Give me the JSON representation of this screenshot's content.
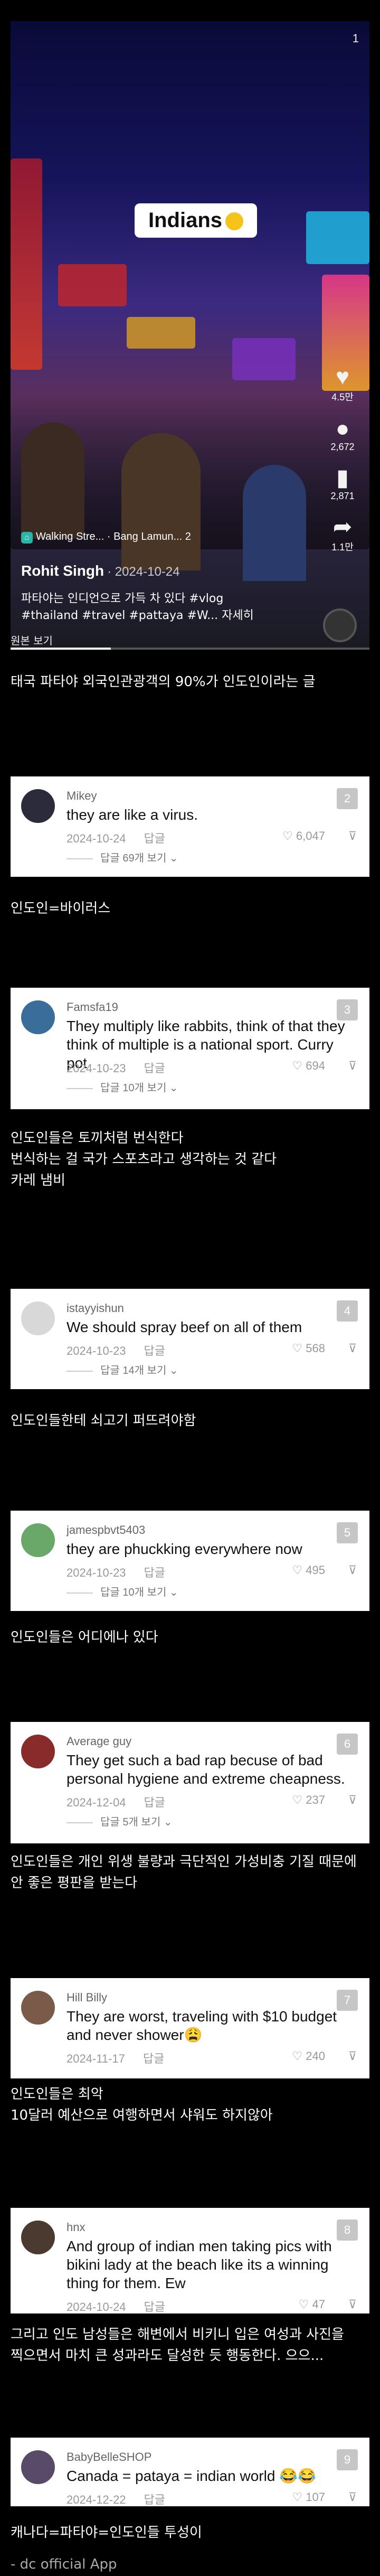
{
  "video": {
    "page_number": "1",
    "caption": "Indians",
    "likes": "4.5만",
    "comments": "2,672",
    "saves": "2,871",
    "shares": "1.1만",
    "location": "Walking Stre... · Bang Lamun...",
    "location_more": "2",
    "author": "Rohit Singh",
    "date": "· 2024-10-24",
    "desc_line1": "파타야는 인디언으로 가득 차 있다 #vlog",
    "desc_line2": "#thailand #travel #pattaya #W...  자세히",
    "progress": 0.28,
    "original_label": "원본 보기"
  },
  "title": "태국 파타야 외국인관광객의 90%가 인도인이라는 글",
  "comments": [
    {
      "rank": "2",
      "user": "Mikey",
      "text": "they are like a virus.",
      "date": "2024-10-24",
      "reply_label": "답글",
      "likes": "6,047",
      "replies": "답글 69개 보기",
      "avatar_color": "#2b2b3c",
      "translation": [
        "인도인=바이러스"
      ]
    },
    {
      "rank": "3",
      "user": "Famsfa19",
      "text": "They multiply like rabbits, think of that they think of multiple is a national sport. Curry pot",
      "date": "2024-10-23",
      "reply_label": "답글",
      "likes": "694",
      "replies": "답글 10개 보기",
      "avatar_color": "#3a6d9a",
      "translation": [
        "인도인들은 토끼처럼 번식한다",
        "번식하는 걸 국가 스포츠라고 생각하는 것 같다",
        "카레 냄비"
      ]
    },
    {
      "rank": "4",
      "user": "istayyishun",
      "text": "We should spray beef on all of them",
      "date": "2024-10-23",
      "reply_label": "답글",
      "likes": "568",
      "replies": "답글 14개 보기",
      "avatar_color": "#d8d8d8",
      "translation": [
        "인도인들한테 쇠고기 퍼뜨려야함"
      ]
    },
    {
      "rank": "5",
      "user": "jamespbvt5403",
      "text": "they are phuckking everywhere now",
      "date": "2024-10-23",
      "reply_label": "답글",
      "likes": "495",
      "replies": "답글 10개 보기",
      "avatar_color": "#6aa86a",
      "translation": [
        "인도인들은 어디에나 있다"
      ]
    },
    {
      "rank": "6",
      "user": "Average guy",
      "text": "They get such a bad rap becuse of bad personal hygiene and extreme cheapness.",
      "date": "2024-12-04",
      "reply_label": "답글",
      "likes": "237",
      "replies": "답글 5개 보기",
      "avatar_color": "#8a2b2b",
      "translation": [
        "인도인들은 개인 위생 불량과 극단적인 가성비충 기질 때문에",
        "안 좋은 평판을 받는다"
      ]
    },
    {
      "rank": "7",
      "user": "Hill Billy",
      "text": "They are worst, traveling with $10 budget and never shower😩",
      "date": "2024-11-17",
      "reply_label": "답글",
      "likes": "240",
      "replies": "",
      "avatar_color": "#7a5a48",
      "translation": [
        "인도인들은 최악",
        "10달러 예산으로 여행하면서 샤워도 하지않아"
      ]
    },
    {
      "rank": "8",
      "user": "hnx",
      "text": "And group of indian men taking pics with bikini lady at the beach like its a winning thing for them. Ew",
      "date": "2024-10-24",
      "reply_label": "답글",
      "likes": "47",
      "replies": "",
      "avatar_color": "#4a3a30",
      "translation": [
        "그리고 인도 남성들은 해변에서 비키니 입은 여성과 사진을",
        "찍으면서 마치 큰 성과라도 달성한 듯 행동한다. 으으..."
      ]
    },
    {
      "rank": "9",
      "user": "BabyBelleSHOP",
      "text": "Canada = pataya = indian world 😂😂",
      "date": "2024-12-22",
      "reply_label": "답글",
      "likes": "107",
      "replies": "",
      "avatar_color": "#5a4a6a",
      "translation": [
        "캐나다=파타야=인도인들 투성이"
      ]
    }
  ],
  "source": "- dc official App"
}
